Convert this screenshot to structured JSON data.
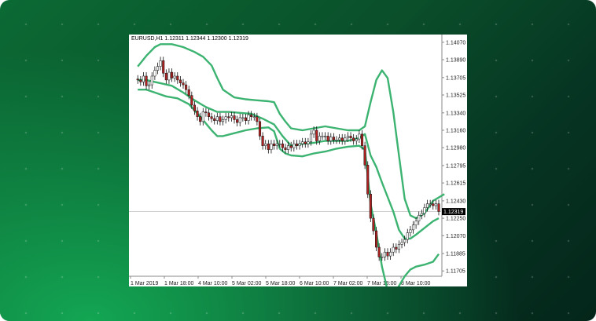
{
  "chart_data": {
    "type": "line",
    "title": "EURUSD,H1  1.12311 1.12344 1.12300 1.12319",
    "symbol": "EURUSD,H1",
    "ohlc": [
      "1.12311",
      "1.12344",
      "1.12300",
      "1.12319"
    ],
    "current_price_label": "1.12319",
    "current_price": 1.12319,
    "ylim": [
      1.1165,
      1.1415
    ],
    "y_ticks": [
      "1.14070",
      "1.13890",
      "1.13705",
      "1.13525",
      "1.13340",
      "1.13160",
      "1.12980",
      "1.12795",
      "1.12615",
      "1.12430",
      "1.12250",
      "1.12070",
      "1.11885",
      "1.11705"
    ],
    "x_ticks": [
      "1 Mar 2019",
      "1 Mar 18:00",
      "4 Mar 10:00",
      "5 Mar 02:00",
      "5 Mar 18:00",
      "6 Mar 10:00",
      "7 Mar 02:00",
      "7 Mar 18:00",
      "8 Mar 10:00"
    ],
    "x_range": [
      0,
      100
    ],
    "series": [
      {
        "kind": "upper_band",
        "color": "#3cb371",
        "points": [
          [
            2,
            1.1382
          ],
          [
            5,
            1.1393
          ],
          [
            8,
            1.1402
          ],
          [
            10,
            1.1405
          ],
          [
            14,
            1.1405
          ],
          [
            18,
            1.1402
          ],
          [
            22,
            1.1397
          ],
          [
            25,
            1.1392
          ],
          [
            28,
            1.1383
          ],
          [
            30,
            1.137
          ],
          [
            32,
            1.1358
          ],
          [
            36,
            1.135
          ],
          [
            40,
            1.1348
          ],
          [
            44,
            1.1347
          ],
          [
            48,
            1.1346
          ],
          [
            50,
            1.1345
          ],
          [
            52,
            1.1333
          ],
          [
            54,
            1.1325
          ],
          [
            56,
            1.1318
          ],
          [
            60,
            1.1316
          ],
          [
            64,
            1.1318
          ],
          [
            68,
            1.132
          ],
          [
            72,
            1.1318
          ],
          [
            76,
            1.1316
          ],
          [
            80,
            1.1316
          ],
          [
            82,
            1.132
          ],
          [
            84,
            1.1345
          ],
          [
            86,
            1.1368
          ],
          [
            88,
            1.1378
          ],
          [
            90,
            1.137
          ],
          [
            92,
            1.1335
          ],
          [
            94,
            1.129
          ],
          [
            96,
            1.1245
          ],
          [
            98,
            1.1228
          ],
          [
            100,
            1.1225
          ],
          [
            103,
            1.123
          ],
          [
            106,
            1.1243
          ],
          [
            110,
            1.125
          ]
        ]
      },
      {
        "kind": "middle_band",
        "color": "#3cb371",
        "points": [
          [
            2,
            1.1368
          ],
          [
            5,
            1.1368
          ],
          [
            8,
            1.1366
          ],
          [
            11,
            1.1364
          ],
          [
            14,
            1.1362
          ],
          [
            18,
            1.1355
          ],
          [
            22,
            1.1347
          ],
          [
            26,
            1.134
          ],
          [
            30,
            1.1335
          ],
          [
            34,
            1.1335
          ],
          [
            38,
            1.1334
          ],
          [
            42,
            1.1333
          ],
          [
            46,
            1.1328
          ],
          [
            50,
            1.1322
          ],
          [
            53,
            1.131
          ],
          [
            56,
            1.13
          ],
          [
            60,
            1.1302
          ],
          [
            64,
            1.1303
          ],
          [
            68,
            1.1305
          ],
          [
            72,
            1.1305
          ],
          [
            76,
            1.1305
          ],
          [
            80,
            1.1308
          ],
          [
            82,
            1.1312
          ],
          [
            84,
            1.129
          ],
          [
            86,
            1.1278
          ],
          [
            88,
            1.1262
          ],
          [
            90,
            1.1247
          ],
          [
            92,
            1.1232
          ],
          [
            94,
            1.1213
          ],
          [
            96,
            1.1204
          ],
          [
            98,
            1.1204
          ],
          [
            100,
            1.1208
          ],
          [
            103,
            1.1215
          ],
          [
            106,
            1.1222
          ],
          [
            108,
            1.1225
          ]
        ]
      },
      {
        "kind": "lower_band",
        "color": "#3cb371",
        "points": [
          [
            2,
            1.1358
          ],
          [
            5,
            1.1358
          ],
          [
            8,
            1.1355
          ],
          [
            10,
            1.1353
          ],
          [
            12,
            1.1351
          ],
          [
            16,
            1.1349
          ],
          [
            20,
            1.1343
          ],
          [
            24,
            1.133
          ],
          [
            28,
            1.1316
          ],
          [
            30,
            1.131
          ],
          [
            32,
            1.131
          ],
          [
            36,
            1.1313
          ],
          [
            40,
            1.1316
          ],
          [
            44,
            1.1318
          ],
          [
            48,
            1.1319
          ],
          [
            50,
            1.1315
          ],
          [
            52,
            1.1297
          ],
          [
            54,
            1.1292
          ],
          [
            56,
            1.129
          ],
          [
            60,
            1.1289
          ],
          [
            64,
            1.1292
          ],
          [
            68,
            1.1294
          ],
          [
            72,
            1.1297
          ],
          [
            76,
            1.1299
          ],
          [
            80,
            1.13
          ],
          [
            82,
            1.1296
          ],
          [
            84,
            1.124
          ],
          [
            86,
            1.121
          ],
          [
            88,
            1.1175
          ],
          [
            90,
            1.115
          ],
          [
            92,
            1.1145
          ],
          [
            94,
            1.1155
          ],
          [
            96,
            1.1165
          ],
          [
            98,
            1.1172
          ],
          [
            100,
            1.1175
          ],
          [
            103,
            1.1177
          ],
          [
            106,
            1.118
          ],
          [
            108,
            1.1188
          ]
        ]
      },
      {
        "kind": "price",
        "color": "#000000",
        "points": [
          [
            0,
            1.1369
          ],
          [
            2,
            1.1368
          ],
          [
            3,
            1.1366
          ],
          [
            4,
            1.1372
          ],
          [
            5,
            1.1362
          ],
          [
            6,
            1.1363
          ],
          [
            7,
            1.1372
          ],
          [
            8,
            1.1378
          ],
          [
            9,
            1.1382
          ],
          [
            10,
            1.1388
          ],
          [
            11,
            1.1375
          ],
          [
            12,
            1.1368
          ],
          [
            13,
            1.1376
          ],
          [
            14,
            1.137
          ],
          [
            15,
            1.1372
          ],
          [
            16,
            1.1368
          ],
          [
            17,
            1.1365
          ],
          [
            18,
            1.1363
          ],
          [
            19,
            1.1358
          ],
          [
            20,
            1.1352
          ],
          [
            21,
            1.1342
          ],
          [
            22,
            1.1336
          ],
          [
            23,
            1.133
          ],
          [
            24,
            1.1325
          ],
          [
            25,
            1.1335
          ],
          [
            26,
            1.1334
          ],
          [
            27,
            1.133
          ],
          [
            28,
            1.1328
          ],
          [
            29,
            1.1326
          ],
          [
            30,
            1.133
          ],
          [
            31,
            1.1325
          ],
          [
            32,
            1.1327
          ],
          [
            33,
            1.133
          ],
          [
            34,
            1.1329
          ],
          [
            35,
            1.1331
          ],
          [
            36,
            1.1327
          ],
          [
            37,
            1.1324
          ],
          [
            38,
            1.1329
          ],
          [
            39,
            1.1329
          ],
          [
            40,
            1.1326
          ],
          [
            41,
            1.1332
          ],
          [
            42,
            1.133
          ],
          [
            43,
            1.133
          ],
          [
            44,
            1.1325
          ],
          [
            45,
            1.131
          ],
          [
            46,
            1.13
          ],
          [
            47,
            1.1302
          ],
          [
            48,
            1.1296
          ],
          [
            49,
            1.1302
          ],
          [
            50,
            1.13
          ],
          [
            51,
            1.1302
          ],
          [
            52,
            1.1302
          ],
          [
            53,
            1.1298
          ],
          [
            54,
            1.1296
          ],
          [
            55,
            1.13
          ],
          [
            56,
            1.1298
          ],
          [
            57,
            1.1302
          ],
          [
            58,
            1.13
          ],
          [
            59,
            1.1302
          ],
          [
            60,
            1.1304
          ],
          [
            61,
            1.1302
          ],
          [
            62,
            1.1304
          ],
          [
            63,
            1.1312
          ],
          [
            64,
            1.1316
          ],
          [
            65,
            1.1305
          ],
          [
            66,
            1.131
          ],
          [
            67,
            1.131
          ],
          [
            68,
            1.131
          ],
          [
            69,
            1.1305
          ],
          [
            70,
            1.1309
          ],
          [
            71,
            1.1306
          ],
          [
            72,
            1.1306
          ],
          [
            73,
            1.1308
          ],
          [
            74,
            1.1305
          ],
          [
            75,
            1.1308
          ],
          [
            76,
            1.131
          ],
          [
            77,
            1.1308
          ],
          [
            78,
            1.1305
          ],
          [
            79,
            1.1307
          ],
          [
            80,
            1.1312
          ],
          [
            81,
            1.13
          ],
          [
            82,
            1.128
          ],
          [
            83,
            1.125
          ],
          [
            84,
            1.1225
          ],
          [
            85,
            1.1212
          ],
          [
            86,
            1.1195
          ],
          [
            87,
            1.1185
          ],
          [
            88,
            1.1185
          ],
          [
            89,
            1.119
          ],
          [
            90,
            1.1186
          ],
          [
            91,
            1.119
          ],
          [
            92,
            1.1195
          ],
          [
            93,
            1.1193
          ],
          [
            94,
            1.1198
          ],
          [
            95,
            1.12
          ],
          [
            96,
            1.1203
          ],
          [
            97,
            1.121
          ],
          [
            98,
            1.1213
          ],
          [
            99,
            1.1218
          ],
          [
            100,
            1.1222
          ],
          [
            101,
            1.1228
          ],
          [
            102,
            1.123
          ],
          [
            103,
            1.1236
          ],
          [
            104,
            1.124
          ],
          [
            105,
            1.124
          ],
          [
            106,
            1.1238
          ],
          [
            107,
            1.124
          ],
          [
            108,
            1.1232
          ]
        ]
      }
    ],
    "grid": false,
    "legend": "none"
  }
}
